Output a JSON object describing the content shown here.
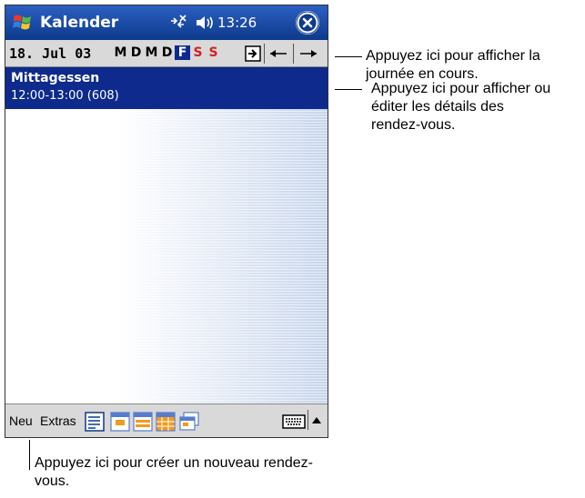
{
  "titlebar": {
    "title": "Kalender",
    "time": "13:26"
  },
  "datebar": {
    "date": "18. Jul 03",
    "days": [
      {
        "label": "M",
        "kind": "normal"
      },
      {
        "label": "D",
        "kind": "normal"
      },
      {
        "label": "M",
        "kind": "normal"
      },
      {
        "label": "D",
        "kind": "normal"
      },
      {
        "label": "F",
        "kind": "today"
      },
      {
        "label": "S",
        "kind": "weekend"
      },
      {
        "label": "S",
        "kind": "weekend"
      }
    ]
  },
  "appointment": {
    "title": "Mittagessen",
    "time": "12:00-13:00 (608)"
  },
  "menubar": {
    "new_label": "Neu",
    "tools_label": "Extras"
  },
  "callouts": {
    "today": "Appuyez ici pour afficher la journée en cours.",
    "details": "Appuyez ici pour afficher ou éditer les détails des rendez-vous.",
    "new": "Appuyez ici pour créer un nouveau rendez-vous."
  },
  "colors": {
    "titlebar": "#1b4aa5",
    "selection": "#0d2a8c",
    "weekend": "#d62020"
  }
}
